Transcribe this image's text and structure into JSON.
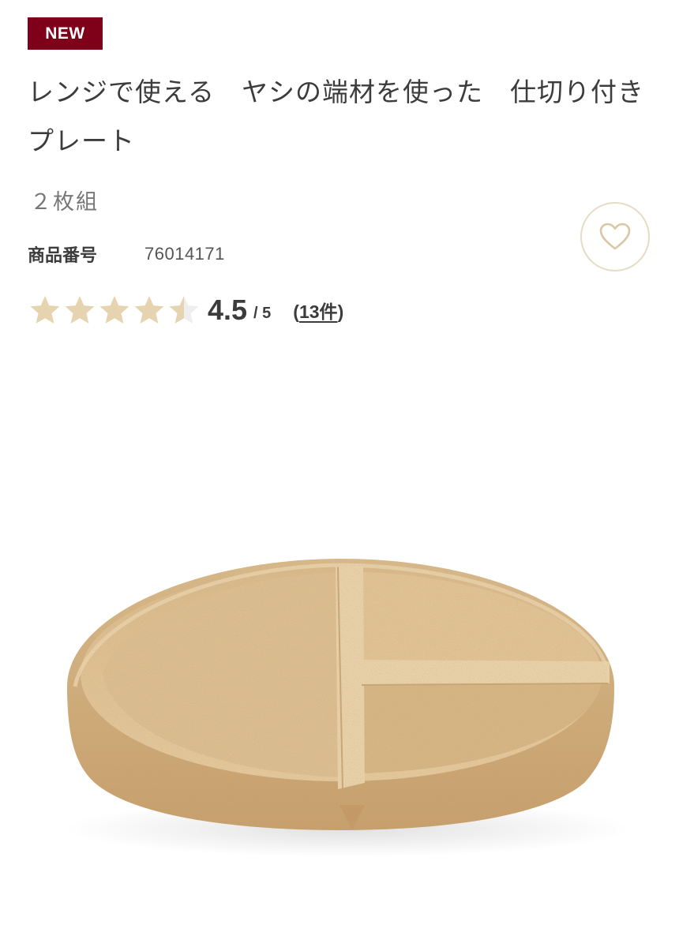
{
  "badge": {
    "label": "NEW"
  },
  "product": {
    "title": "レンジで使える　ヤシの端材を使った　仕切り付きプレート",
    "subtitle": "２枚組",
    "sku_label": "商品番号",
    "sku_value": "76014171"
  },
  "rating": {
    "value": "4.5",
    "max": "/ 5",
    "value_fraction": 0.9,
    "reviews_open": "(",
    "reviews_count": "13件",
    "reviews_close": ")"
  },
  "icons": {
    "favorite": "heart-icon",
    "star": "star-icon"
  },
  "colors": {
    "badge_bg": "#7f0019",
    "star_fill": "#e6d4b0",
    "star_empty": "#eeeeee",
    "heart_stroke": "#d9c7a8",
    "fav_border": "#e7dbc6"
  }
}
